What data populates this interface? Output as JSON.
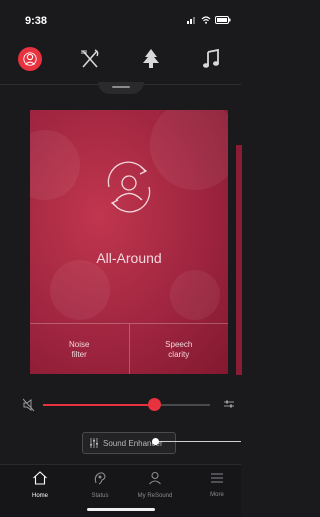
{
  "status_bar": {
    "time": "9:38"
  },
  "programs": [
    {
      "name": "person-icon",
      "active": true
    },
    {
      "name": "restaurant-icon",
      "active": false
    },
    {
      "name": "tree-icon",
      "active": false
    },
    {
      "name": "music-icon",
      "active": false
    }
  ],
  "program_card": {
    "title": "All-Around",
    "left_option": {
      "line1": "Noise",
      "line2": "filter"
    },
    "right_option": {
      "line1": "Speech",
      "line2": "clarity"
    }
  },
  "volume": {
    "level_fraction": 0.72
  },
  "sound_enhancer": {
    "label": "Sound Enhancer"
  },
  "tabs": [
    {
      "label": "Home",
      "icon": "home-icon",
      "active": true
    },
    {
      "label": "Status",
      "icon": "status-icon",
      "active": false
    },
    {
      "label": "My ReSound",
      "icon": "profile-icon",
      "active": false
    },
    {
      "label": "More",
      "icon": "menu-icon",
      "active": false
    }
  ],
  "colors": {
    "accent": "#e8323f",
    "card": "#a02540",
    "background": "#1a1a1c"
  }
}
